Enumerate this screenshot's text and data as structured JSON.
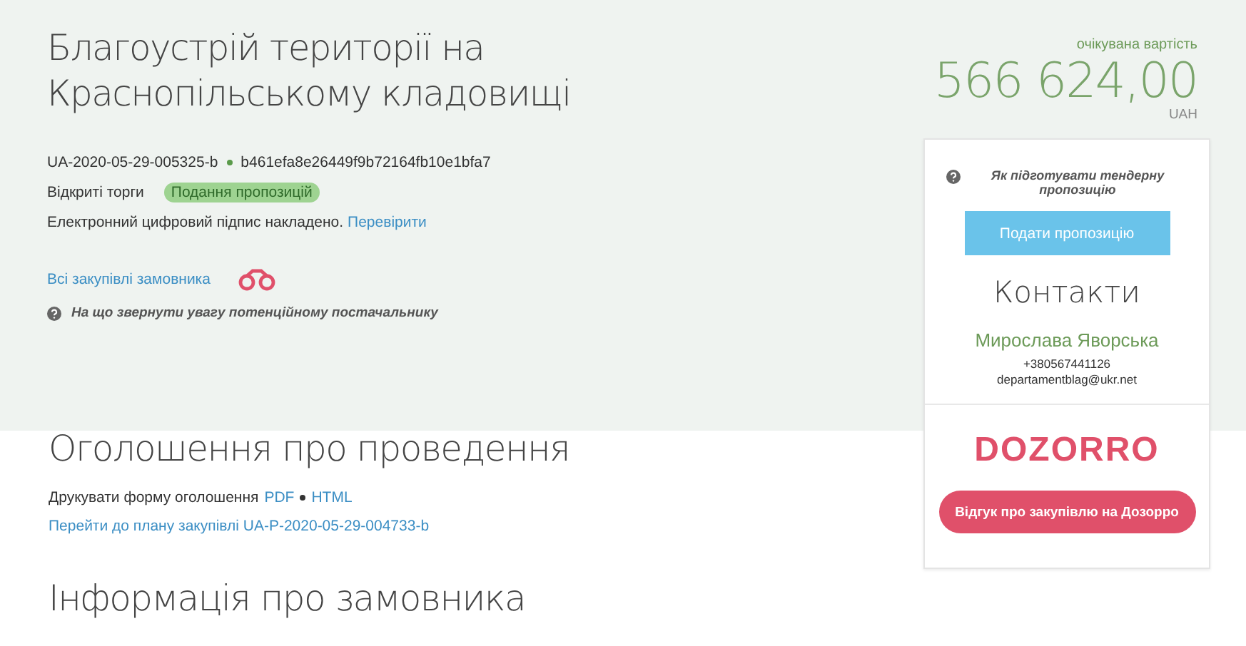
{
  "title": "Благоустрій території на Краснопільському кладовищі",
  "tender_id": "UA-2020-05-29-005325-b",
  "hash": "b461efa8e26449f9b72164fb10e1bfa7",
  "procedure": "Відкриті торги",
  "status": {
    "label": "Подання пропозицій",
    "color": "#9ed391"
  },
  "signature": {
    "text": "Електронний цифровий підпис накладено.",
    "link": "Перевірити"
  },
  "buyer_link": "Всі закупівлі замовника",
  "hint": "На що звернути увагу потенційному постачальнику",
  "price": {
    "label": "очікувана вартість",
    "amount": "566 624,00",
    "currency": "UAH"
  },
  "card": {
    "hint": "Як підготувати тендерну пропозицію",
    "submit": "Подати пропозицію",
    "contacts_title": "Контакти",
    "name": "Мирослава Яворська",
    "phone": "+380567441126",
    "email": "departamentblag@ukr.net",
    "logo": "DOZORRO",
    "feedback": "Відгук про закупівлю на Дозорро"
  },
  "announcement": {
    "title": "Оголошення про проведення",
    "print_label": "Друкувати форму оголошення",
    "formats": [
      "PDF",
      "HTML"
    ],
    "plan_link": "Перейти до плану закупівлі UA-P-2020-05-29-004733-b"
  },
  "buyer_section": {
    "title": "Інформація про замовника"
  }
}
